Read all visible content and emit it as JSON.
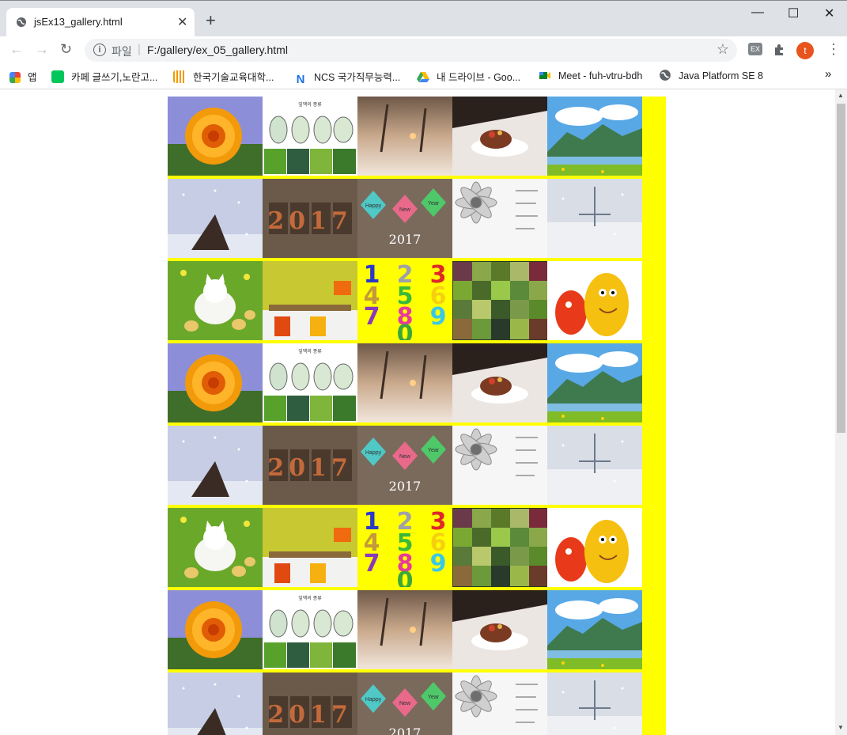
{
  "tab": {
    "title": "jsEx13_gallery.html",
    "close": "✕",
    "new_tab": "+"
  },
  "window": {
    "minimize": "—",
    "maximize": "☐",
    "close": "✕"
  },
  "toolbar": {
    "back": "←",
    "forward": "→",
    "reload": "↻",
    "scheme": "파일",
    "separator": "|",
    "url": "F:/gallery/ex_05_gallery.html",
    "star": "☆",
    "ext_label": "EX",
    "profile_initial": "t",
    "menu": "⋮"
  },
  "bookmarks": [
    {
      "label": "앱",
      "icon": "apps-grid-icon",
      "color": "#4285f4"
    },
    {
      "label": "카페 글쓰기,노란고...",
      "icon": "cafe-icon",
      "color": "#03c75a"
    },
    {
      "label": "한국기술교육대학...",
      "icon": "koreatech-icon",
      "color": "#f29900"
    },
    {
      "label": "NCS 국가직무능력...",
      "icon": "ncs-icon",
      "color": "#1a73e8"
    },
    {
      "label": "내 드라이브 - Goo...",
      "icon": "google-drive-icon",
      "color": "#34a853"
    },
    {
      "label": "Meet - fuh-vtru-bdh",
      "icon": "google-meet-icon",
      "color": "#00832d"
    },
    {
      "label": "Java Platform SE 8",
      "icon": "globe-icon",
      "color": "#5f6368"
    }
  ],
  "bookmarks_overflow": "»",
  "gallery": {
    "background": "#ffff00",
    "images": [
      "flower",
      "leaves",
      "snow-street",
      "cake",
      "mountain",
      "winter-tree",
      "year-2017",
      "happy-new-year",
      "daisy",
      "snow-scene",
      "kitten",
      "room",
      "numbers",
      "succulents",
      "larva"
    ],
    "rows": [
      [
        0,
        1,
        2,
        3,
        4
      ],
      [
        5,
        6,
        7,
        8,
        9
      ],
      [
        10,
        11,
        12,
        13,
        14
      ],
      [
        0,
        1,
        2,
        3,
        4
      ],
      [
        5,
        6,
        7,
        8,
        9
      ],
      [
        10,
        11,
        12,
        13,
        14
      ],
      [
        0,
        1,
        2,
        3,
        4
      ],
      [
        5,
        6,
        7,
        8,
        9
      ]
    ],
    "text": {
      "year": "2017",
      "happy": "Happy",
      "new": "New",
      "yr": "Year",
      "digits": [
        "1",
        "2",
        "3",
        "4",
        "5",
        "6",
        "7",
        "8",
        "9",
        "0"
      ],
      "leaves_title": "잎맥의 종류"
    }
  }
}
